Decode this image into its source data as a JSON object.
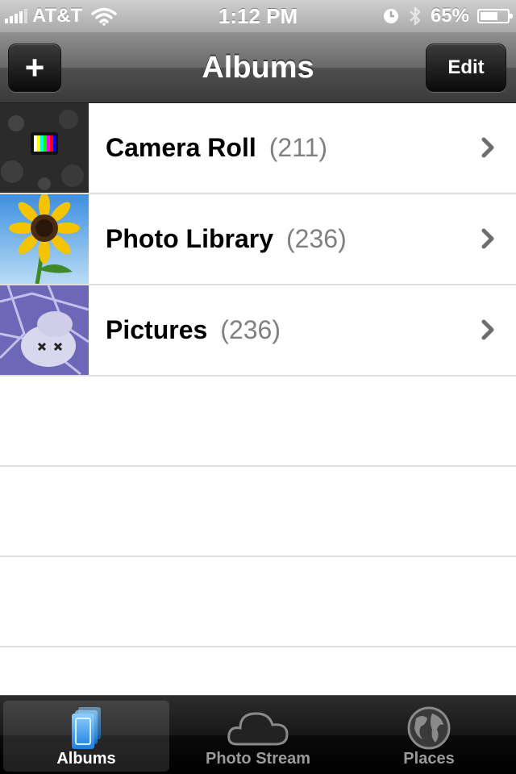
{
  "status_bar": {
    "carrier": "AT&T",
    "time": "1:12 PM",
    "battery": "65%",
    "battery_level": 0.65,
    "icons": [
      "signal-bars-icon",
      "wifi-icon",
      "alarm-clock-icon",
      "bluetooth-icon",
      "battery-icon"
    ]
  },
  "nav": {
    "title": "Albums",
    "add_label": "+",
    "edit_label": "Edit"
  },
  "albums": [
    {
      "name": "Camera Roll",
      "count": "(211)"
    },
    {
      "name": "Photo Library",
      "count": "(236)"
    },
    {
      "name": "Pictures",
      "count": "(236)"
    }
  ],
  "tabs": [
    {
      "label": "Albums",
      "icon": "albums-icon",
      "selected": true
    },
    {
      "label": "Photo Stream",
      "icon": "cloud-icon",
      "selected": false
    },
    {
      "label": "Places",
      "icon": "globe-icon",
      "selected": false
    }
  ],
  "colors": {
    "accent_selected_tab": "#4aa8ff",
    "count_text": "#808080"
  }
}
